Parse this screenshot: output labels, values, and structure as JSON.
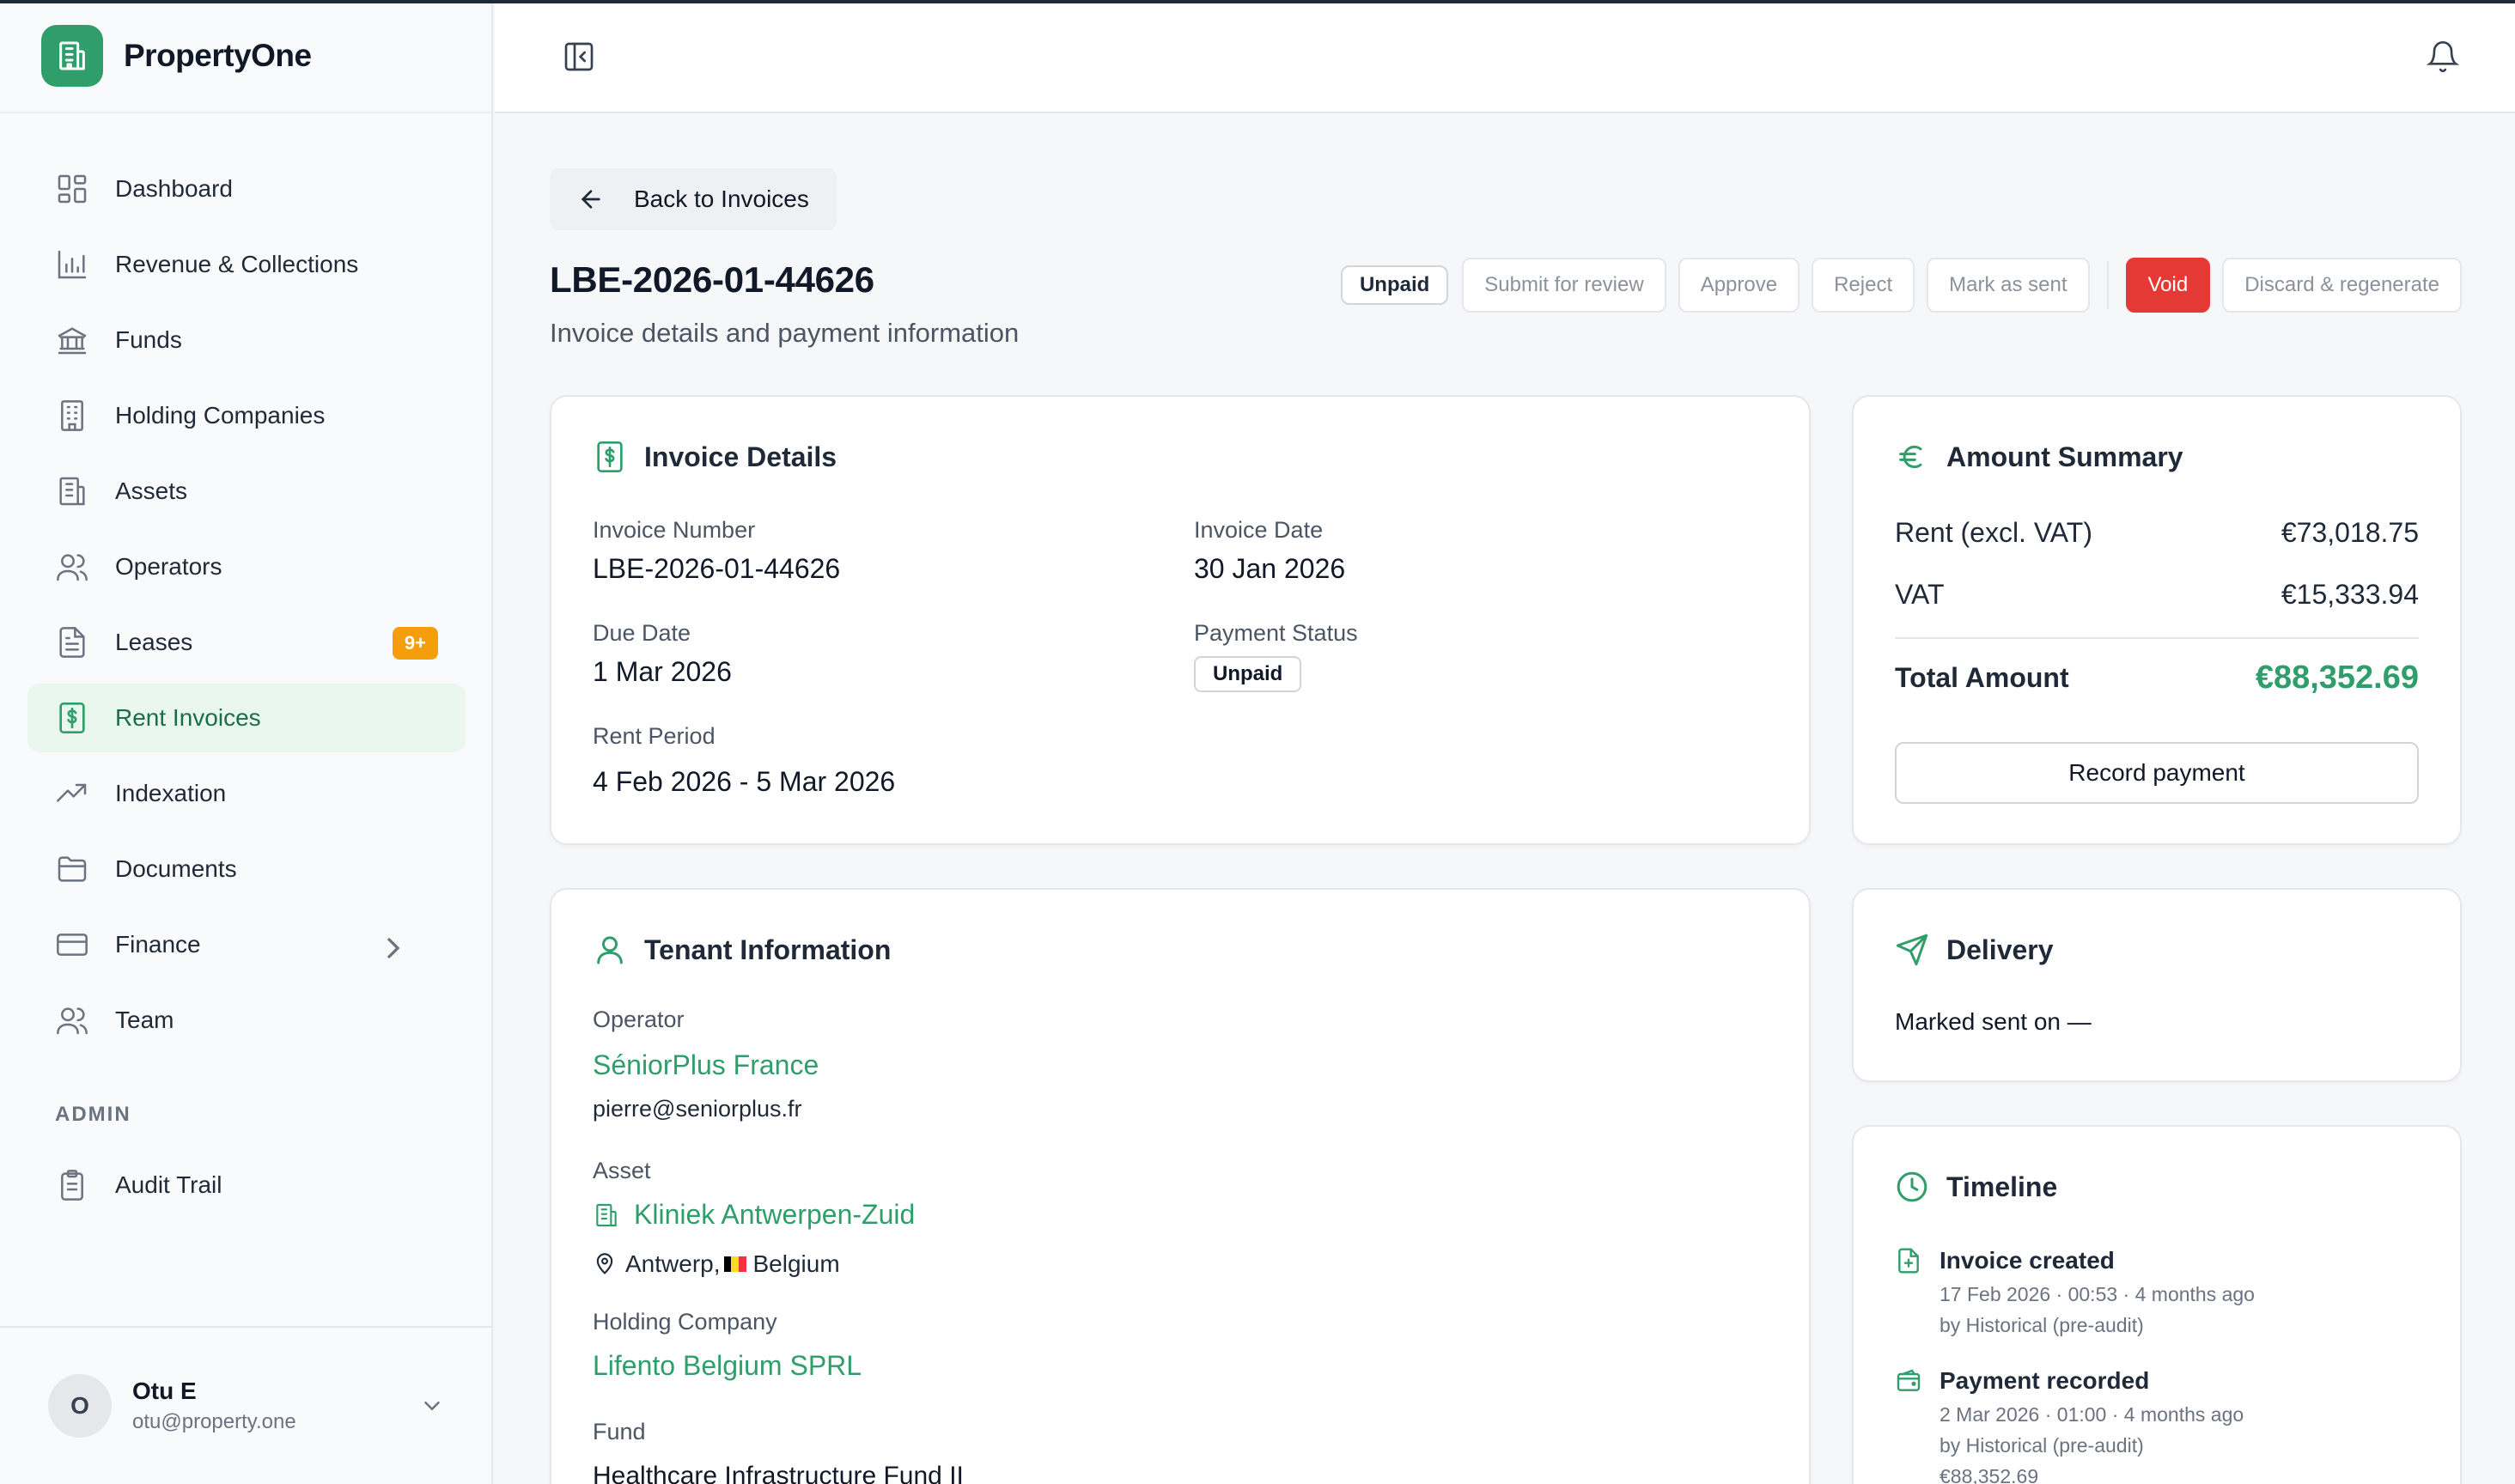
{
  "app": {
    "name": "PropertyOne"
  },
  "sidebar": {
    "items": [
      {
        "label": "Dashboard"
      },
      {
        "label": "Revenue & Collections"
      },
      {
        "label": "Funds"
      },
      {
        "label": "Holding Companies"
      },
      {
        "label": "Assets"
      },
      {
        "label": "Operators"
      },
      {
        "label": "Leases",
        "badge": "9+"
      },
      {
        "label": "Rent Invoices",
        "active": true
      },
      {
        "label": "Indexation"
      },
      {
        "label": "Documents"
      },
      {
        "label": "Finance"
      },
      {
        "label": "Team"
      }
    ],
    "admin_label": "ADMIN",
    "admin_items": [
      {
        "label": "Audit Trail"
      }
    ]
  },
  "user": {
    "initial": "O",
    "name": "Otu E",
    "email": "otu@property.one"
  },
  "page": {
    "back_label": "Back to Invoices",
    "title": "LBE-2026-01-44626",
    "subtitle": "Invoice details and payment information"
  },
  "actions": {
    "status": "Unpaid",
    "submit": "Submit for review",
    "approve": "Approve",
    "reject": "Reject",
    "mark_sent": "Mark as sent",
    "void": "Void",
    "discard": "Discard & regenerate"
  },
  "invoice_details": {
    "title": "Invoice Details",
    "invoice_number_label": "Invoice Number",
    "invoice_number": "LBE-2026-01-44626",
    "invoice_date_label": "Invoice Date",
    "invoice_date": "30 Jan 2026",
    "due_date_label": "Due Date",
    "due_date": "1 Mar 2026",
    "payment_status_label": "Payment Status",
    "payment_status": "Unpaid",
    "rent_period_label": "Rent Period",
    "rent_period": "4 Feb 2026 - 5 Mar 2026"
  },
  "amount_summary": {
    "title": "Amount Summary",
    "rent_label": "Rent (excl. VAT)",
    "rent_value": "€73,018.75",
    "vat_label": "VAT",
    "vat_value": "€15,333.94",
    "total_label": "Total Amount",
    "total_value": "€88,352.69",
    "record_label": "Record payment",
    "accent": "#2f9e6b"
  },
  "tenant": {
    "title": "Tenant Information",
    "operator_label": "Operator",
    "operator_name": "SéniorPlus France",
    "operator_email": "pierre@seniorplus.fr",
    "asset_label": "Asset",
    "asset_name": "Kliniek Antwerpen-Zuid",
    "city": "Antwerp,",
    "country": "Belgium",
    "holding_label": "Holding Company",
    "holding_name": "Lifento Belgium SPRL",
    "fund_label": "Fund",
    "fund_name": "Healthcare Infrastructure Fund II"
  },
  "delivery": {
    "title": "Delivery",
    "marked_sent": "Marked sent on —"
  },
  "timeline": {
    "title": "Timeline",
    "events": [
      {
        "title": "Invoice created",
        "when": "17 Feb 2026 · 00:53 · 4 months ago",
        "by": "by Historical (pre-audit)"
      },
      {
        "title": "Payment recorded",
        "when": "2 Mar 2026 · 01:00 · 4 months ago",
        "by": "by Historical (pre-audit)",
        "amount": "€88,352.69"
      }
    ]
  },
  "colors": {
    "brand": "#2f9e6b",
    "danger": "#e53935",
    "badge": "#f59e0b"
  }
}
